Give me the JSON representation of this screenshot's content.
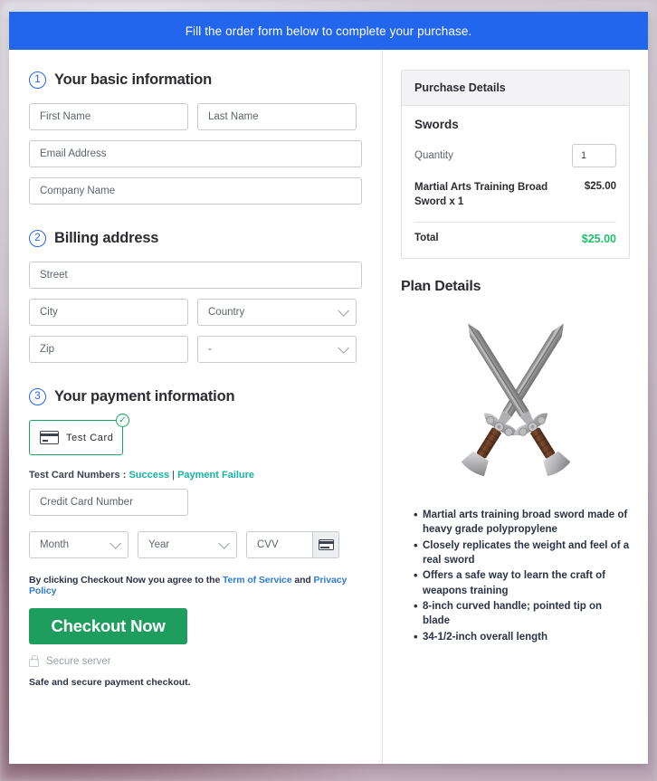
{
  "banner": {
    "message": "Fill the order form below to complete your purchase."
  },
  "steps": {
    "one": {
      "number": "1",
      "title": "Your basic information"
    },
    "two": {
      "number": "2",
      "title": "Billing address"
    },
    "three": {
      "number": "3",
      "title": "Your payment information"
    }
  },
  "basic_info": {
    "first_name_placeholder": "First Name",
    "last_name_placeholder": "Last Name",
    "email_placeholder": "Email Address",
    "company_placeholder": "Company Name"
  },
  "billing": {
    "street_placeholder": "Street",
    "city_placeholder": "City",
    "country_placeholder": "Country",
    "zip_placeholder": "Zip",
    "state_placeholder": "-"
  },
  "payment": {
    "card_tile_label": "Test  Card",
    "card_tile_selected": true,
    "test_numbers_prefix": "Test Card Numbers : ",
    "test_numbers_success": "Success",
    "test_numbers_separator": " | ",
    "test_numbers_failure": "Payment Failure",
    "card_number_placeholder": "Credit Card Number",
    "month_placeholder": "Month",
    "year_placeholder": "Year",
    "cvv_placeholder": "CVV"
  },
  "footer": {
    "terms_prefix": "By clicking Checkout Now you agree to the ",
    "terms_link": "Term of Service",
    "terms_middle": " and ",
    "privacy_link": "Privacy Policy",
    "checkout_label": "Checkout Now",
    "secure_server": "Secure server",
    "safe_note": "Safe and secure payment checkout."
  },
  "purchase": {
    "header": "Purchase Details",
    "product": "Swords",
    "quantity_label": "Quantity",
    "quantity_value": "1",
    "line_item_name": "Martial Arts Training Broad Sword x 1",
    "line_item_price": "$25.00",
    "total_label": "Total",
    "total_value": "$25.00"
  },
  "plan": {
    "title": "Plan Details",
    "image_alt": "crossed-swords-image",
    "features": [
      "Martial arts training broad sword made of heavy grade polypropylene",
      "Closely replicates the weight and feel of a real sword",
      "Offers a safe way to learn the craft of weapons training",
      "8-inch curved handle; pointed tip on blade",
      "34-1/2-inch overall length"
    ]
  },
  "colors": {
    "banner_blue": "#2266ee",
    "accent_green": "#1d9e5e",
    "total_green": "#1fbf6d",
    "link_teal": "#17b3a3",
    "link_blue": "#2f7bd8",
    "selected_border": "#17a762"
  }
}
